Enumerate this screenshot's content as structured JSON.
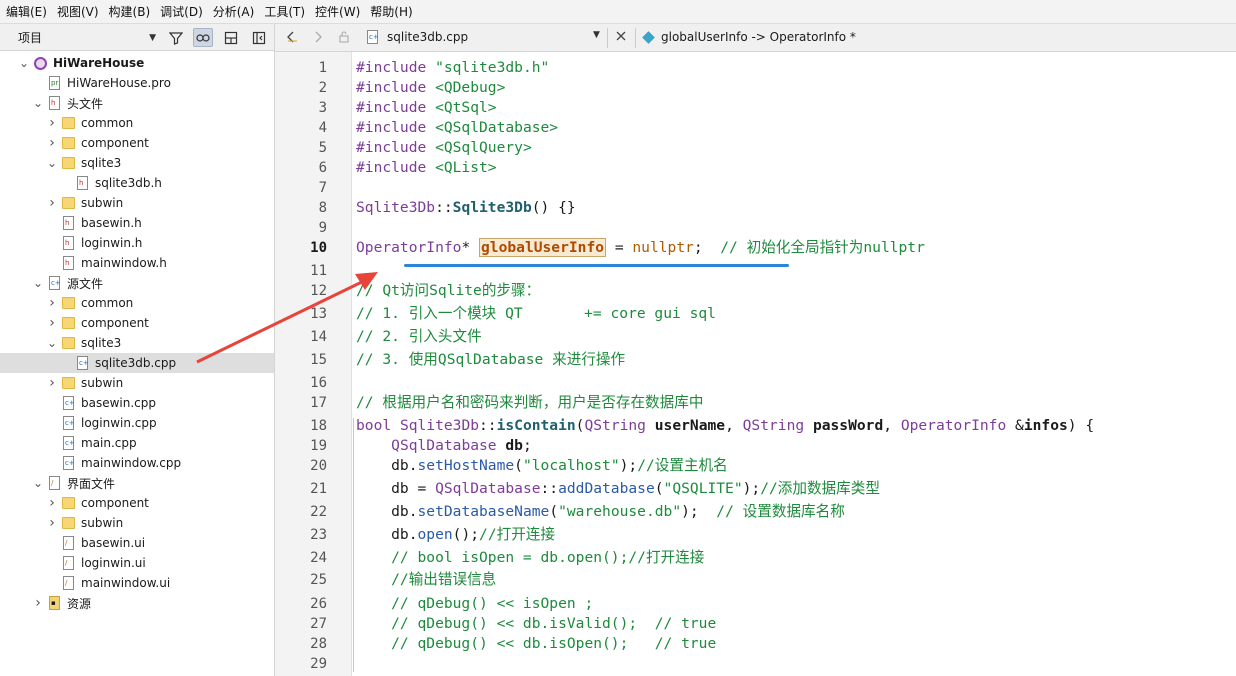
{
  "menu": [
    "编辑(E)",
    "视图(V)",
    "构建(B)",
    "调试(D)",
    "分析(A)",
    "工具(T)",
    "控件(W)",
    "帮助(H)"
  ],
  "left_toolbar": {
    "project_label": "项目"
  },
  "tree": [
    {
      "label": "HiWareHouse",
      "type": "project",
      "arrow": "down",
      "level": 0,
      "bold": true
    },
    {
      "label": "HiWareHouse.pro",
      "type": "pro",
      "arrow": "",
      "level": 1
    },
    {
      "label": "头文件",
      "type": "hdir",
      "arrow": "down",
      "level": 1
    },
    {
      "label": "common",
      "type": "folder",
      "arrow": "right",
      "level": 2
    },
    {
      "label": "component",
      "type": "folder",
      "arrow": "right",
      "level": 2
    },
    {
      "label": "sqlite3",
      "type": "folder",
      "arrow": "down",
      "level": 2
    },
    {
      "label": "sqlite3db.h",
      "type": "h",
      "arrow": "",
      "level": 3
    },
    {
      "label": "subwin",
      "type": "folder",
      "arrow": "right",
      "level": 2
    },
    {
      "label": "basewin.h",
      "type": "h",
      "arrow": "",
      "level": 2
    },
    {
      "label": "loginwin.h",
      "type": "h",
      "arrow": "",
      "level": 2
    },
    {
      "label": "mainwindow.h",
      "type": "h",
      "arrow": "",
      "level": 2
    },
    {
      "label": "源文件",
      "type": "cdir",
      "arrow": "down",
      "level": 1
    },
    {
      "label": "common",
      "type": "folder",
      "arrow": "right",
      "level": 2
    },
    {
      "label": "component",
      "type": "folder",
      "arrow": "right",
      "level": 2
    },
    {
      "label": "sqlite3",
      "type": "folder",
      "arrow": "down",
      "level": 2
    },
    {
      "label": "sqlite3db.cpp",
      "type": "cpp",
      "arrow": "",
      "level": 3,
      "selected": true
    },
    {
      "label": "subwin",
      "type": "folder",
      "arrow": "right",
      "level": 2
    },
    {
      "label": "basewin.cpp",
      "type": "cpp",
      "arrow": "",
      "level": 2
    },
    {
      "label": "loginwin.cpp",
      "type": "cpp",
      "arrow": "",
      "level": 2
    },
    {
      "label": "main.cpp",
      "type": "cpp",
      "arrow": "",
      "level": 2
    },
    {
      "label": "mainwindow.cpp",
      "type": "cpp",
      "arrow": "",
      "level": 2
    },
    {
      "label": "界面文件",
      "type": "udir",
      "arrow": "down",
      "level": 1
    },
    {
      "label": "component",
      "type": "folder",
      "arrow": "right",
      "level": 2
    },
    {
      "label": "subwin",
      "type": "folder",
      "arrow": "right",
      "level": 2
    },
    {
      "label": "basewin.ui",
      "type": "ui",
      "arrow": "",
      "level": 2
    },
    {
      "label": "loginwin.ui",
      "type": "ui",
      "arrow": "",
      "level": 2
    },
    {
      "label": "mainwindow.ui",
      "type": "ui",
      "arrow": "",
      "level": 2
    },
    {
      "label": "资源",
      "type": "rdir",
      "arrow": "right",
      "level": 1
    }
  ],
  "editor_header": {
    "file_name": "sqlite3db.cpp",
    "symbol": "globalUserInfo -> OperatorInfo *"
  },
  "editor": {
    "current_line": 10,
    "lines": [
      {
        "n": 1,
        "tokens": [
          [
            "kw",
            "#include "
          ],
          [
            "str",
            "\"sqlite3db.h\""
          ]
        ]
      },
      {
        "n": 2,
        "tokens": [
          [
            "kw",
            "#include "
          ],
          [
            "str",
            "<QDebug>"
          ]
        ]
      },
      {
        "n": 3,
        "tokens": [
          [
            "kw",
            "#include "
          ],
          [
            "str",
            "<QtSql>"
          ]
        ]
      },
      {
        "n": 4,
        "tokens": [
          [
            "kw",
            "#include "
          ],
          [
            "str",
            "<QSqlDatabase>"
          ]
        ]
      },
      {
        "n": 5,
        "tokens": [
          [
            "kw",
            "#include "
          ],
          [
            "str",
            "<QSqlQuery>"
          ]
        ]
      },
      {
        "n": 6,
        "tokens": [
          [
            "kw",
            "#include "
          ],
          [
            "str",
            "<QList>"
          ]
        ]
      },
      {
        "n": 7,
        "tokens": []
      },
      {
        "n": 8,
        "tokens": [
          [
            "ty",
            "Sqlite3Db"
          ],
          [
            "plain",
            "::"
          ],
          [
            "bfn",
            "Sqlite3Db"
          ],
          [
            "plain",
            "() {}"
          ]
        ]
      },
      {
        "n": 9,
        "tokens": []
      },
      {
        "n": 10,
        "tokens": [
          [
            "ty",
            "OperatorInfo"
          ],
          [
            "plain",
            "* "
          ],
          [
            "glob",
            "globalUserInfo"
          ],
          [
            "plain",
            " = "
          ],
          [
            "num",
            "nullptr"
          ],
          [
            "plain",
            ";  "
          ],
          [
            "cm",
            "// 初始化全局指针为nullptr"
          ]
        ]
      },
      {
        "n": 11,
        "tokens": []
      },
      {
        "n": 12,
        "tokens": [
          [
            "cm",
            "// Qt访问Sqlite的步骤："
          ]
        ]
      },
      {
        "n": 13,
        "tokens": [
          [
            "cm",
            "// 1. 引入一个模块 QT       += core gui sql"
          ]
        ]
      },
      {
        "n": 14,
        "tokens": [
          [
            "cm",
            "// 2. 引入头文件"
          ]
        ]
      },
      {
        "n": 15,
        "tokens": [
          [
            "cm",
            "// 3. 使用QSqlDatabase 来进行操作"
          ]
        ]
      },
      {
        "n": 16,
        "tokens": []
      },
      {
        "n": 17,
        "tokens": [
          [
            "cm",
            "// 根据用户名和密码来判断，用户是否存在数据库中"
          ]
        ]
      },
      {
        "n": 18,
        "tokens": [
          [
            "kw",
            "bool "
          ],
          [
            "ty",
            "Sqlite3Db"
          ],
          [
            "plain",
            "::"
          ],
          [
            "bfn",
            "isContain"
          ],
          [
            "plain",
            "("
          ],
          [
            "ty",
            "QString "
          ],
          [
            "var",
            "userName"
          ],
          [
            "plain",
            ", "
          ],
          [
            "ty",
            "QString "
          ],
          [
            "var",
            "passWord"
          ],
          [
            "plain",
            ", "
          ],
          [
            "ty",
            "OperatorInfo "
          ],
          [
            "plain",
            "&"
          ],
          [
            "var",
            "infos"
          ],
          [
            "plain",
            ") {"
          ]
        ]
      },
      {
        "n": 19,
        "tokens": [
          [
            "plain",
            "    "
          ],
          [
            "ty",
            "QSqlDatabase "
          ],
          [
            "var",
            "db"
          ],
          [
            "plain",
            ";"
          ]
        ]
      },
      {
        "n": 20,
        "tokens": [
          [
            "plain",
            "    db."
          ],
          [
            "fn",
            "setHostName"
          ],
          [
            "plain",
            "("
          ],
          [
            "str",
            "\"localhost\""
          ],
          [
            "plain",
            ");"
          ],
          [
            "cm",
            "//设置主机名"
          ]
        ]
      },
      {
        "n": 21,
        "tokens": [
          [
            "plain",
            "    db = "
          ],
          [
            "ty",
            "QSqlDatabase"
          ],
          [
            "plain",
            "::"
          ],
          [
            "fn",
            "addDatabase"
          ],
          [
            "plain",
            "("
          ],
          [
            "str",
            "\"QSQLITE\""
          ],
          [
            "plain",
            ");"
          ],
          [
            "cm",
            "//添加数据库类型"
          ]
        ]
      },
      {
        "n": 22,
        "tokens": [
          [
            "plain",
            "    db."
          ],
          [
            "fn",
            "setDatabaseName"
          ],
          [
            "plain",
            "("
          ],
          [
            "str",
            "\"warehouse.db\""
          ],
          [
            "plain",
            ");  "
          ],
          [
            "cm",
            "// 设置数据库名称"
          ]
        ]
      },
      {
        "n": 23,
        "tokens": [
          [
            "plain",
            "    db."
          ],
          [
            "fn",
            "open"
          ],
          [
            "plain",
            "();"
          ],
          [
            "cm",
            "//打开连接"
          ]
        ]
      },
      {
        "n": 24,
        "tokens": [
          [
            "cm",
            "    // bool isOpen = db.open();//打开连接"
          ]
        ]
      },
      {
        "n": 25,
        "tokens": [
          [
            "cm",
            "    //输出错误信息"
          ]
        ]
      },
      {
        "n": 26,
        "tokens": [
          [
            "cm",
            "    // qDebug() << isOpen ;"
          ]
        ]
      },
      {
        "n": 27,
        "tokens": [
          [
            "cm",
            "    // qDebug() << db.isValid();  // true"
          ]
        ]
      },
      {
        "n": 28,
        "tokens": [
          [
            "cm",
            "    // qDebug() << db.isOpen();   // true"
          ]
        ]
      },
      {
        "n": 29,
        "tokens": []
      }
    ]
  },
  "colors": {
    "annotation_arrow": "#e8443a",
    "underline": "#2a86d6"
  },
  "icons": {
    "filter": "filter-icon",
    "link": "link-icon",
    "split": "split-icon",
    "close_sidebar": "close-sidebar-icon",
    "back": "back-icon",
    "forward": "forward-icon",
    "lock": "lock-icon",
    "close": "close-icon",
    "symbol": "symbol-diamond-icon"
  }
}
